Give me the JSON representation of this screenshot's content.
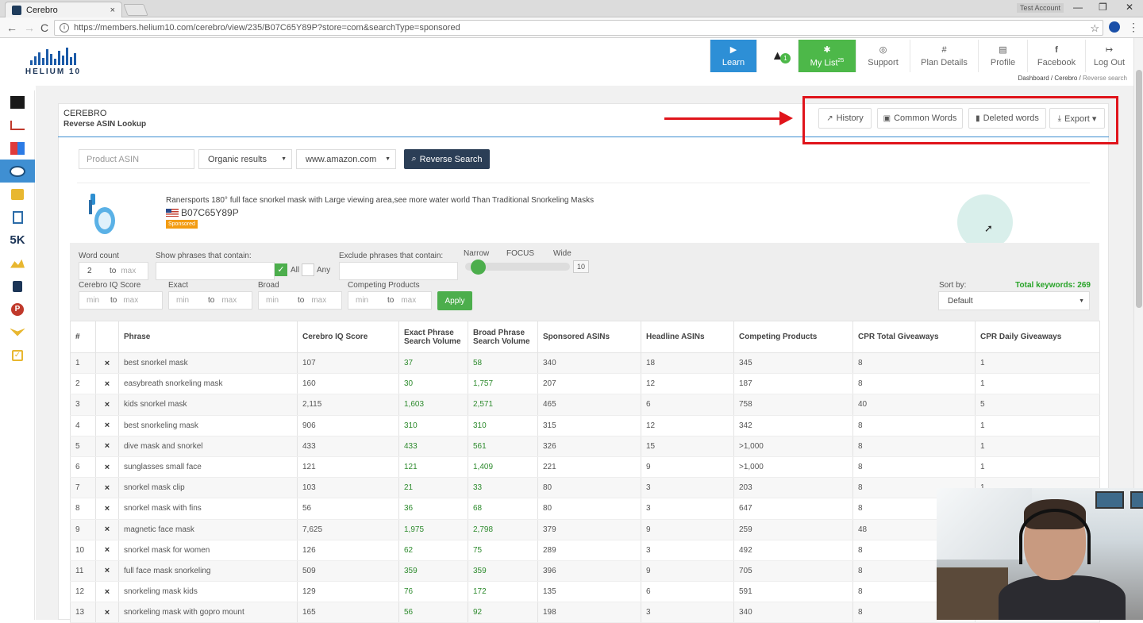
{
  "browser": {
    "tab_title": "Cerebro",
    "tab_close": "×",
    "account_label": "Test Account",
    "url": "https://members.helium10.com/cerebro/view/235/B07C65Y89P?store=com&searchType=sponsored",
    "window_controls": {
      "minimize": "—",
      "restore": "❐",
      "close": "✕"
    },
    "nav": {
      "back": "←",
      "forward": "→",
      "reload": "C",
      "star": "☆",
      "menu": "⋮"
    }
  },
  "brand": {
    "logo_text": "HELIUM 10",
    "accent": "#1c5ba8"
  },
  "topnav": {
    "learn": "Learn",
    "bell_count": "1",
    "mylist": "My List",
    "mylist_count": "25",
    "support": "Support",
    "plan_details": "Plan Details",
    "profile": "Profile",
    "facebook": "Facebook",
    "logout": "Log Out",
    "icons": {
      "learn": "▶",
      "bell": "🔔",
      "mylist": "📌",
      "support": "◎",
      "plan": "#",
      "profile": "▤",
      "facebook": "f",
      "logout": "↦"
    }
  },
  "breadcrumb": {
    "dashboard": "Dashboard",
    "sep1": "/",
    "cerebro": "Cerebro",
    "sep2": "/",
    "current": "Reverse search"
  },
  "panel": {
    "title": "CEREBRO",
    "subtitle": "Reverse ASIN Lookup",
    "buttons": {
      "history": "History",
      "common_words": "Common Words",
      "deleted_words": "Deleted words",
      "export": "Export ▾"
    },
    "icons": {
      "history": "📈",
      "common_words": "▣",
      "deleted_words": "▮",
      "export": "⤓"
    }
  },
  "search": {
    "asin_placeholder": "Product ASIN",
    "results_select": "Organic results",
    "marketplace_select": "www.amazon.com",
    "button": "Reverse Search",
    "caret": "▼"
  },
  "product": {
    "title": "Ranersports 180° full face snorkel mask with Large viewing area,see more water world Than Traditional Snorkeling Masks",
    "asin": "B07C65Y89P",
    "badge": "Sponsored"
  },
  "filters": {
    "word_count": "Word count",
    "word_count_min": "2",
    "to": "to",
    "max": "max",
    "min": "min",
    "show_phrases": "Show phrases that contain:",
    "all": "All",
    "any": "Any",
    "exclude_phrases": "Exclude phrases that contain:",
    "narrow": "Narrow",
    "focus": "FOCUS",
    "wide": "Wide",
    "focus_value": "10",
    "cerebro_iq": "Cerebro IQ Score",
    "exact": "Exact",
    "broad": "Broad",
    "competing": "Competing Products",
    "apply": "Apply",
    "sort_by": "Sort by:",
    "sort_value": "Default",
    "total_keywords": "Total keywords: 269",
    "check": "✓"
  },
  "table": {
    "headers": [
      "#",
      "",
      "Phrase",
      "Cerebro IQ Score",
      "Exact Phrase Search Volume",
      "Broad Phrase Search Volume",
      "Sponsored ASINs",
      "Headline ASINs",
      "Competing Products",
      "CPR Total Giveaways",
      "CPR Daily Giveaways"
    ],
    "rows": [
      [
        "1",
        "×",
        "best snorkel mask",
        "107",
        "37",
        "58",
        "340",
        "18",
        "345",
        "8",
        "1"
      ],
      [
        "2",
        "×",
        "easybreath snorkeling mask",
        "160",
        "30",
        "1,757",
        "207",
        "12",
        "187",
        "8",
        "1"
      ],
      [
        "3",
        "×",
        "kids snorkel mask",
        "2,115",
        "1,603",
        "2,571",
        "465",
        "6",
        "758",
        "40",
        "5"
      ],
      [
        "4",
        "×",
        "best snorkeling mask",
        "906",
        "310",
        "310",
        "315",
        "12",
        "342",
        "8",
        "1"
      ],
      [
        "5",
        "×",
        "dive mask and snorkel",
        "433",
        "433",
        "561",
        "326",
        "15",
        ">1,000",
        "8",
        "1"
      ],
      [
        "6",
        "×",
        "sunglasses small face",
        "121",
        "121",
        "1,409",
        "221",
        "9",
        ">1,000",
        "8",
        "1"
      ],
      [
        "7",
        "×",
        "snorkel mask clip",
        "103",
        "21",
        "33",
        "80",
        "3",
        "203",
        "8",
        "1"
      ],
      [
        "8",
        "×",
        "snorkel mask with fins",
        "56",
        "36",
        "68",
        "80",
        "3",
        "647",
        "8",
        ""
      ],
      [
        "9",
        "×",
        "magnetic face mask",
        "7,625",
        "1,975",
        "2,798",
        "379",
        "9",
        "259",
        "48",
        ""
      ],
      [
        "10",
        "×",
        "snorkel mask for women",
        "126",
        "62",
        "75",
        "289",
        "3",
        "492",
        "8",
        ""
      ],
      [
        "11",
        "×",
        "full face mask snorkeling",
        "509",
        "359",
        "359",
        "396",
        "9",
        "705",
        "8",
        ""
      ],
      [
        "12",
        "×",
        "snorkeling mask kids",
        "129",
        "76",
        "172",
        "135",
        "6",
        "591",
        "8",
        ""
      ],
      [
        "13",
        "×",
        "snorkeling mask with gopro mount",
        "165",
        "56",
        "92",
        "198",
        "3",
        "340",
        "8",
        ""
      ]
    ]
  },
  "colors": {
    "accent_blue": "#2d8fd6",
    "green": "#4db849",
    "highlight_red": "#e0141b",
    "dark_button": "#2b3e56"
  }
}
